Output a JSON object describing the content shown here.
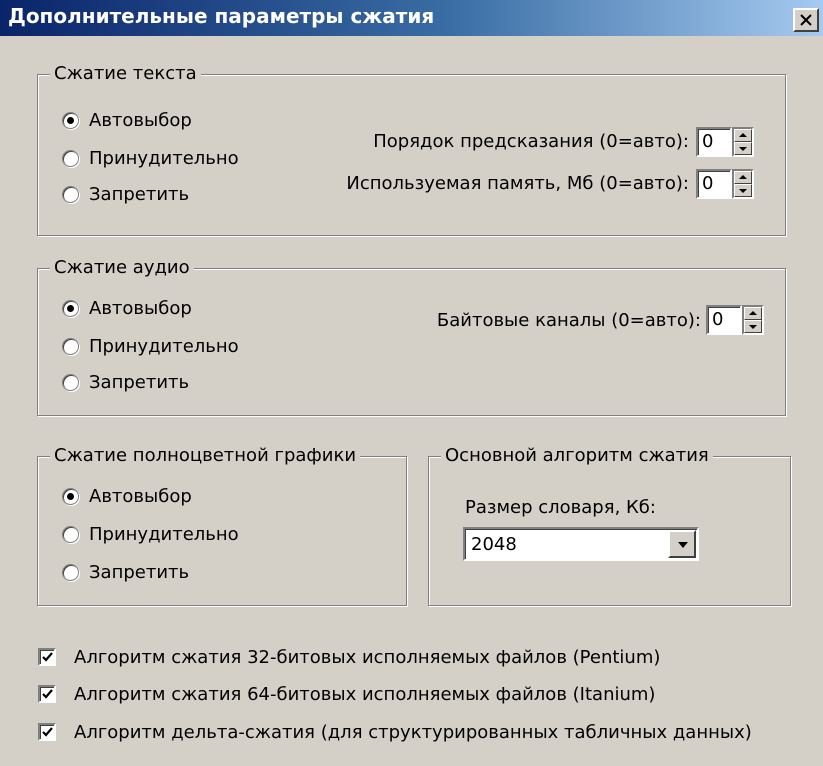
{
  "window": {
    "title": "Дополнительные параметры сжатия"
  },
  "text_group": {
    "legend": "Сжатие текста",
    "options": [
      "Автовыбор",
      "Принудительно",
      "Запретить"
    ],
    "selected": 0,
    "prediction_order_label": "Порядок предсказания (0=авто):",
    "prediction_order_value": "0",
    "memory_label": "Используемая память, Мб (0=авто):",
    "memory_value": "0"
  },
  "audio_group": {
    "legend": "Сжатие аудио",
    "options": [
      "Автовыбор",
      "Принудительно",
      "Запретить"
    ],
    "selected": 0,
    "byte_channels_label": "Байтовые каналы (0=авто):",
    "byte_channels_value": "0"
  },
  "graphics_group": {
    "legend": "Сжатие полноцветной графики",
    "options": [
      "Автовыбор",
      "Принудительно",
      "Запретить"
    ],
    "selected": 0
  },
  "algorithm_group": {
    "legend": "Основной алгоритм сжатия",
    "dict_label": "Размер словаря, Кб:",
    "dict_value": "2048"
  },
  "checkboxes": [
    {
      "label": "Алгоритм сжатия 32-битовых исполняемых файлов (Pentium)",
      "checked": true
    },
    {
      "label": "Алгоритм сжатия 64-битовых исполняемых файлов (Itanium)",
      "checked": true
    },
    {
      "label": "Алгоритм дельта-сжатия (для структурированных табличных данных)",
      "checked": true
    }
  ]
}
